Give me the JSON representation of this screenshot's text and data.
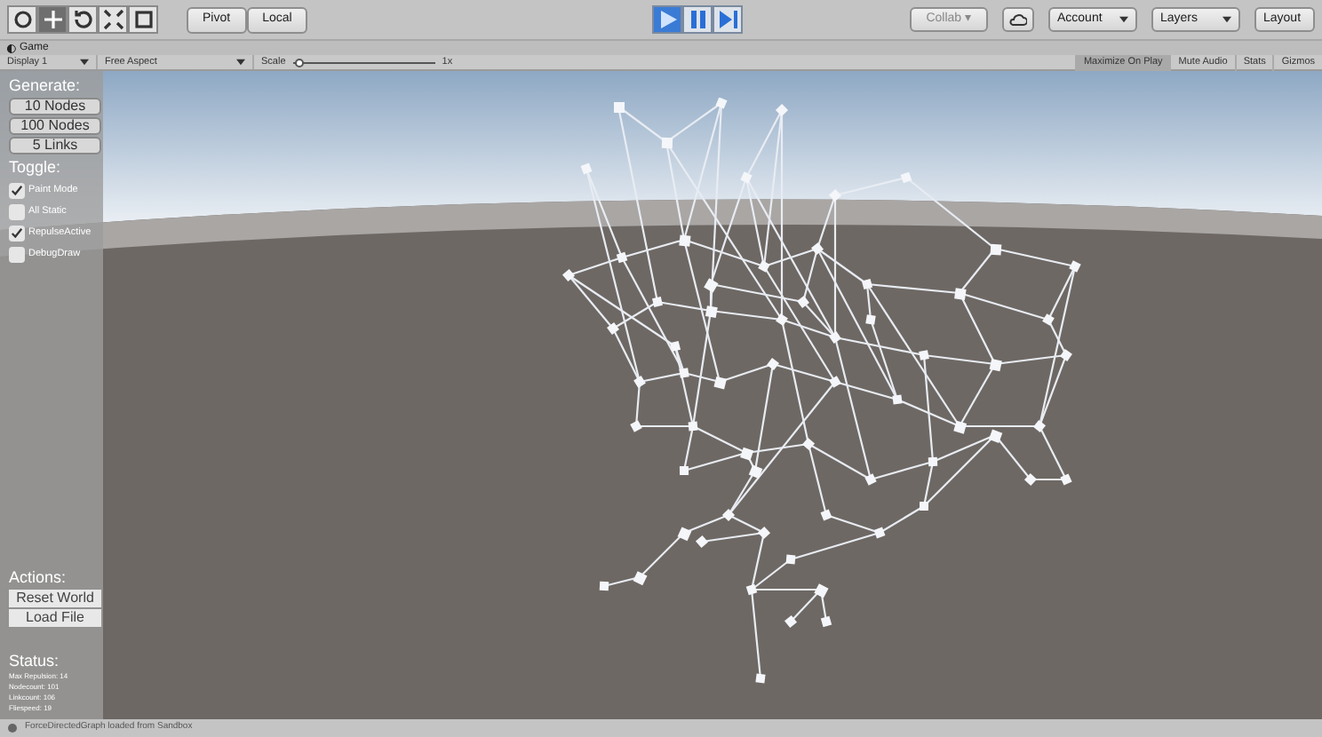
{
  "toolbar": {
    "tools": [
      {
        "kind": "hand",
        "selected": false
      },
      {
        "kind": "move",
        "selected": true
      },
      {
        "kind": "rotate",
        "selected": false
      },
      {
        "kind": "scale",
        "selected": false
      },
      {
        "kind": "rect",
        "selected": false
      }
    ],
    "pivot": "Pivot",
    "local": "Local",
    "playback": [
      {
        "kind": "play",
        "selected": true
      },
      {
        "kind": "pause",
        "selected": false
      },
      {
        "kind": "step",
        "selected": false
      }
    ],
    "collab": "Collab ▾",
    "account": "Account",
    "layers": "Layers",
    "layout": "Layout"
  },
  "tab": {
    "title": "Game"
  },
  "game_bar": {
    "display": "Display 1",
    "aspect": "Free Aspect",
    "scale_label": "Scale",
    "scale_value": "1x",
    "level": 0.02,
    "toggles": [
      {
        "label": "Maximize On Play",
        "selected": true
      },
      {
        "label": "Mute Audio",
        "selected": false
      },
      {
        "label": "Stats",
        "selected": false
      },
      {
        "label": "Gizmos",
        "selected": false
      }
    ]
  },
  "panel": {
    "generate_heading": "Generate:",
    "generate_buttons": [
      "10 Nodes",
      "100 Nodes",
      "5 Links"
    ],
    "toggle_heading": "Toggle:",
    "toggles": [
      {
        "label": "Paint Mode",
        "checked": true
      },
      {
        "label": "All Static",
        "checked": false
      },
      {
        "label": "RepulseActive",
        "checked": true
      },
      {
        "label": "DebugDraw",
        "checked": false
      }
    ],
    "actions_heading": "Actions:",
    "action_buttons": [
      "Reset World",
      "Load File"
    ],
    "status_heading": "Status:",
    "status_lines": [
      "Max Repulsion: 14",
      "Nodecount: 101",
      "Linkcount: 106",
      "Fliespeed: 19"
    ]
  },
  "status_bar": {
    "message": "ForceDirectedGraph loaded from Sandbox"
  }
}
